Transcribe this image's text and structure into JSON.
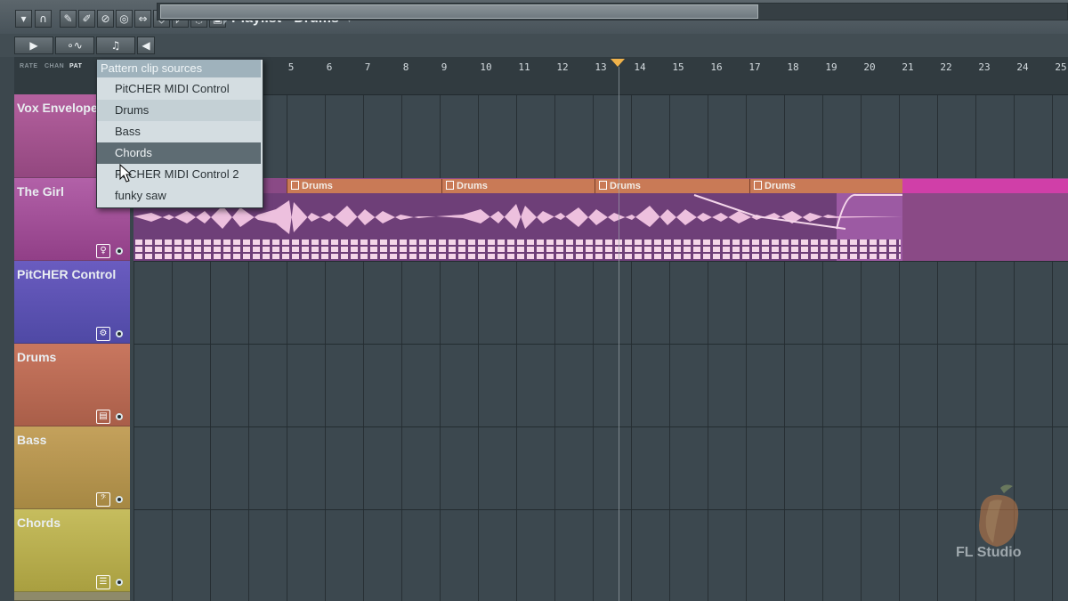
{
  "window": {
    "title": "Playlist - Drums"
  },
  "toolbar": {
    "buttons": [
      {
        "name": "menu-arrow-button",
        "glyph": "▾"
      },
      {
        "name": "magnet-button",
        "glyph": "∩"
      },
      {
        "name": "pencil-button",
        "glyph": "✎"
      },
      {
        "name": "paint-brush-button",
        "glyph": "✐"
      },
      {
        "name": "delete-button",
        "glyph": "⊘"
      },
      {
        "name": "mute-button",
        "glyph": "◎"
      },
      {
        "name": "slip-button",
        "glyph": "⇔"
      },
      {
        "name": "slice-button",
        "glyph": "◇"
      },
      {
        "name": "select-button",
        "glyph": "◸"
      },
      {
        "name": "zoom-button",
        "glyph": "◌"
      },
      {
        "name": "playback-button",
        "glyph": "▣"
      }
    ]
  },
  "row2": {
    "btn1": "▶",
    "btn2": "∘∿",
    "btn3": "♫",
    "btn4": "◀"
  },
  "tabs": {
    "rate": "RATE",
    "chan": "CHAN",
    "pat": "PAT"
  },
  "ruler": {
    "labels": [
      "5",
      "6",
      "7",
      "8",
      "9",
      "10",
      "11",
      "12",
      "13",
      "14",
      "15",
      "16",
      "17",
      "18",
      "19",
      "20",
      "21",
      "22",
      "23",
      "24",
      "25"
    ]
  },
  "tracks": [
    {
      "name": "Vox Envelope",
      "color": "#a4548f"
    },
    {
      "name": "The Girl",
      "color": "#a0519a"
    },
    {
      "name": "PitCHER Control",
      "color": "#6656b6"
    },
    {
      "name": "Drums",
      "color": "#c0715c"
    },
    {
      "name": "Bass",
      "color": "#b79855"
    },
    {
      "name": "Chords",
      "color": "#b8b054"
    }
  ],
  "clips": [
    {
      "label": "Drums"
    },
    {
      "label": "Drums"
    },
    {
      "label": "Drums"
    },
    {
      "label": "Drums"
    }
  ],
  "dropdown": {
    "title": "Pattern clip sources",
    "items": [
      "PitCHER MIDI Control",
      "Drums",
      "Bass",
      "Chords",
      "PitCHER MIDI Control 2",
      "funky saw"
    ],
    "selected": "Chords"
  },
  "logo": {
    "text": "FL Studio"
  }
}
